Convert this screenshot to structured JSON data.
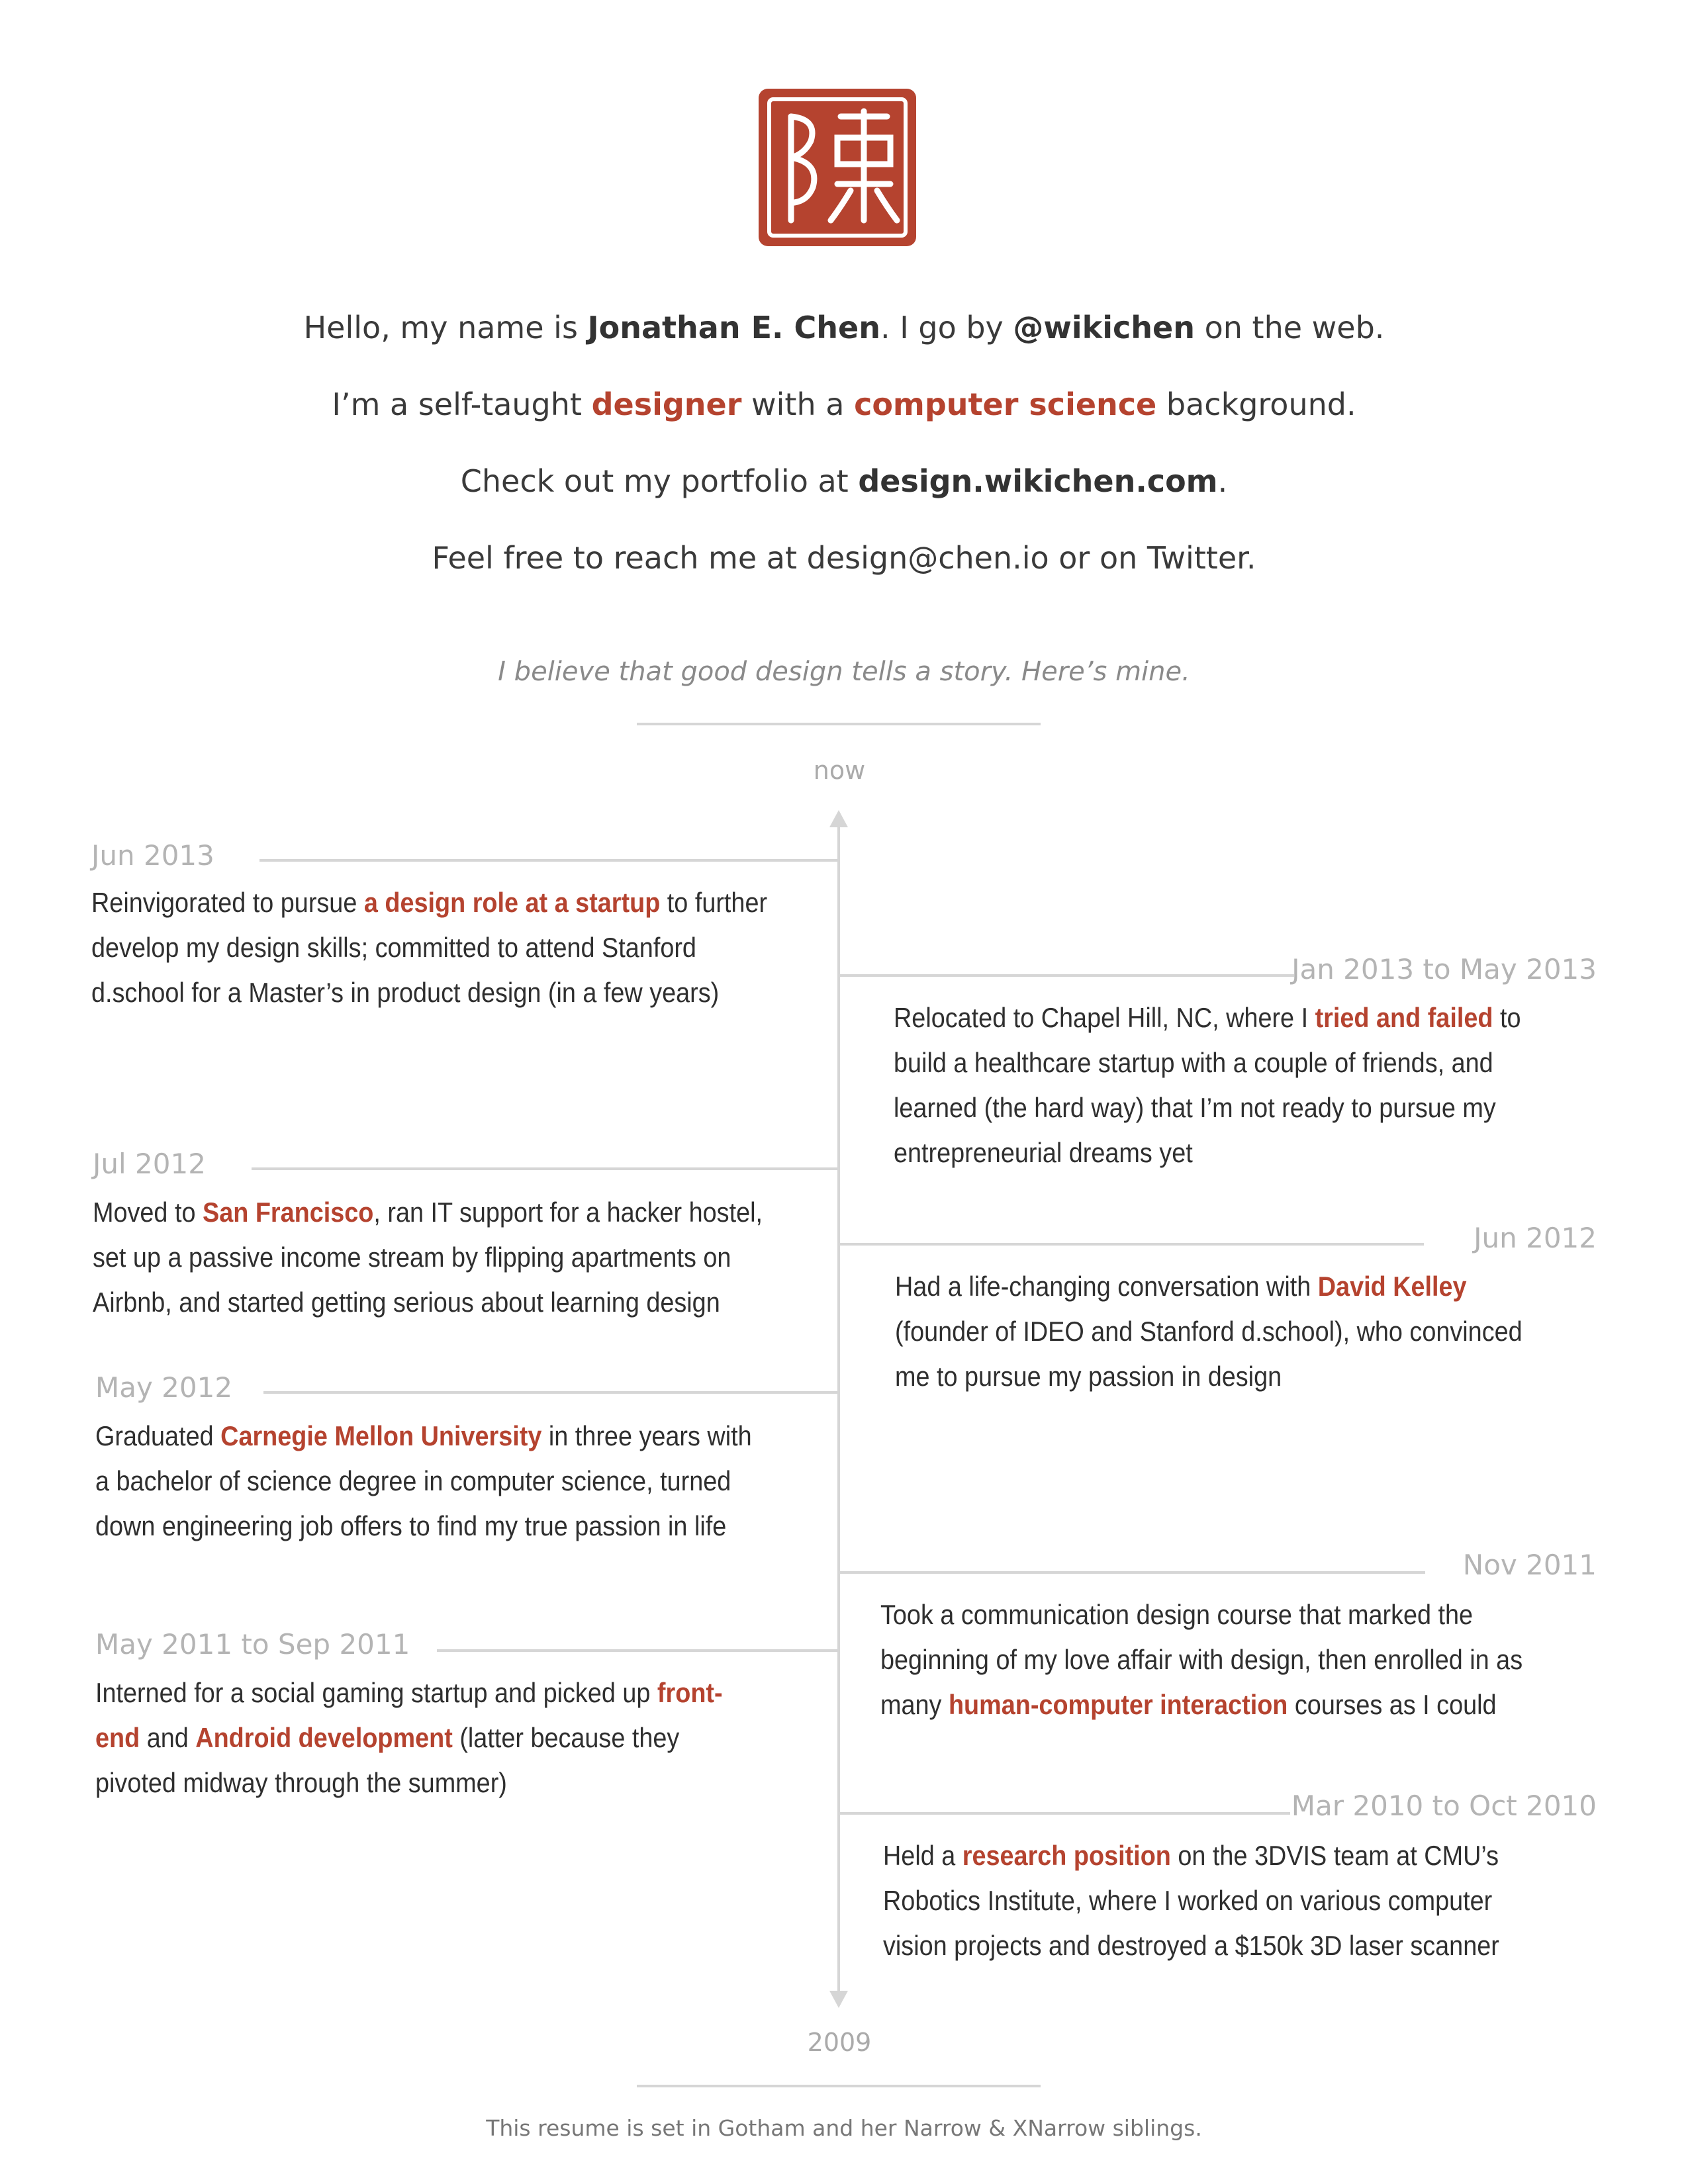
{
  "intro": {
    "line1": [
      "Hello, my name is ",
      "Jonathan E. Chen",
      ". I go by ",
      "@wikichen",
      " on the web."
    ],
    "line2": [
      "I’m a self-taught ",
      "designer",
      " with a ",
      "computer science",
      " background."
    ],
    "line3": [
      "Check out my portfolio at ",
      "design.wikichen.com",
      "."
    ],
    "line4": "Feel free to reach me at design@chen.io or on Twitter."
  },
  "story": "I believe that good design tells a story. Here’s mine.",
  "axis": {
    "top": "now",
    "bottom": "2009"
  },
  "colors": {
    "accent": "#b5432f",
    "line": "#d6d6d6",
    "date": "#b4b4b4"
  },
  "entries": [
    {
      "date": "Jun 2013",
      "lines": [
        [
          "Reinvigorated to pursue ",
          {
            "hl": "a design role at a startup"
          },
          " to further"
        ],
        [
          "develop my design skills; committed to attend Stanford"
        ],
        [
          "d.school for a Master’s in product design (in a few years)"
        ]
      ]
    },
    {
      "date": "Jan 2013 to May 2013",
      "lines": [
        [
          "Relocated to Chapel Hill, NC, where I ",
          {
            "hl": "tried and failed"
          },
          " to"
        ],
        [
          "build a healthcare startup with a couple of friends, and"
        ],
        [
          "learned (the hard way) that I’m not ready to pursue my"
        ],
        [
          "entrepreneurial dreams yet"
        ]
      ]
    },
    {
      "date": "Jul 2012",
      "lines": [
        [
          "Moved to ",
          {
            "hl": "San Francisco"
          },
          ", ran IT support for a hacker hostel,"
        ],
        [
          "set up a passive income stream by flipping apartments on"
        ],
        [
          "Airbnb, and started getting serious about learning design"
        ]
      ]
    },
    {
      "date": "Jun 2012",
      "lines": [
        [
          "Had a life-changing conversation with ",
          {
            "hl": "David Kelley"
          }
        ],
        [
          "(founder of IDEO and Stanford d.school), who convinced"
        ],
        [
          "me to pursue my passion in design"
        ]
      ]
    },
    {
      "date": "May 2012",
      "lines": [
        [
          "Graduated ",
          {
            "hl": "Carnegie Mellon University"
          },
          " in three years with"
        ],
        [
          "a bachelor of science degree in computer science, turned"
        ],
        [
          "down engineering job offers to find my true passion in life"
        ]
      ]
    },
    {
      "date": "Nov 2011",
      "lines": [
        [
          "Took a communication design course that marked the"
        ],
        [
          "beginning of my love affair with design, then enrolled in as"
        ],
        [
          "many ",
          {
            "hl": "human-computer interaction"
          },
          " courses as I could"
        ]
      ]
    },
    {
      "date": "May 2011 to Sep 2011",
      "lines": [
        [
          "Interned for a social gaming startup and picked up ",
          {
            "hl": "front-"
          }
        ],
        [
          {
            "hl": "end"
          },
          " and ",
          {
            "hl": "Android development"
          },
          " (latter because they"
        ],
        [
          "pivoted midway through the summer)"
        ]
      ]
    },
    {
      "date": "Mar 2010 to Oct 2010",
      "lines": [
        [
          "Held a ",
          {
            "hl": "research position"
          },
          " on the 3DVIS team at CMU’s"
        ],
        [
          "Robotics Institute, where I worked on various computer"
        ],
        [
          "vision projects and destroyed a $150k 3D laser scanner"
        ]
      ]
    }
  ],
  "footer": "This resume is set in Gotham and her Narrow & XNarrow siblings."
}
